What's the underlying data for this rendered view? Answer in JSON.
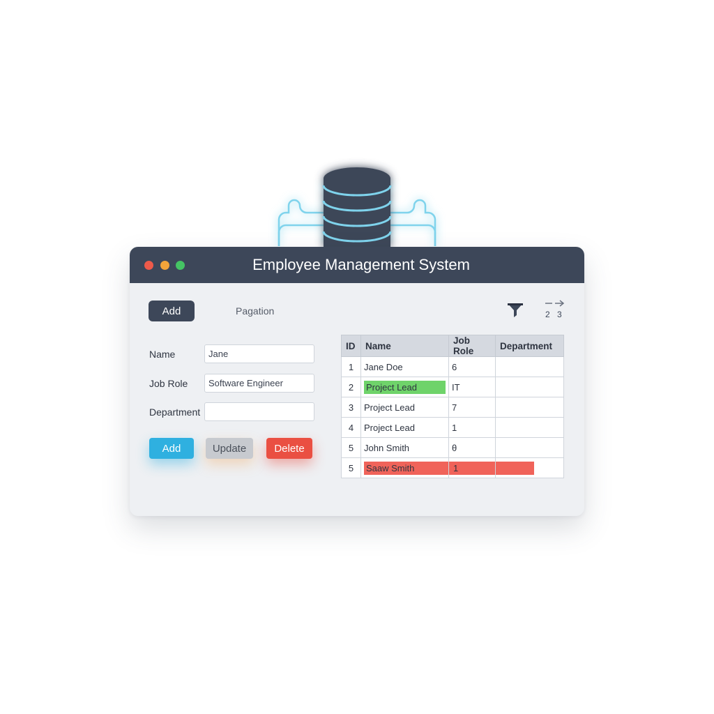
{
  "window": {
    "title": "Employee Management System"
  },
  "colors": {
    "titlebar": "#3d4759",
    "dot_red": "#ee5a4a",
    "dot_yellow": "#f2a43a",
    "dot_green": "#45c464",
    "accent_blue": "#2fb0e0",
    "danger_red": "#ea4f42",
    "highlight_green": "#6fd36a",
    "highlight_red": "#f0635a"
  },
  "toolbar": {
    "add_label": "Add",
    "pagination_label": "Pagation",
    "filter_icon": "filter-funnel-icon",
    "pager_icon": "pagination-arrows-icon",
    "pager_numbers": [
      "2",
      "3"
    ]
  },
  "form": {
    "fields": [
      {
        "label": "Name",
        "value": "Jane"
      },
      {
        "label": "Job Role",
        "value": "Software Engineer"
      },
      {
        "label": "Department",
        "value": ""
      }
    ],
    "buttons": {
      "add": "Add",
      "update": "Update",
      "delete": "Delete"
    }
  },
  "table": {
    "headers": [
      "ID",
      "Name",
      "Job Role",
      "Department"
    ],
    "rows": [
      {
        "id": "1",
        "name": "Jane Doe",
        "job_role": "6",
        "department": "",
        "highlight": ""
      },
      {
        "id": "2",
        "name": "Project Lead",
        "job_role": "IT",
        "department": "",
        "highlight": "green"
      },
      {
        "id": "3",
        "name": "Project Lead",
        "job_role": "7",
        "department": "",
        "highlight": ""
      },
      {
        "id": "4",
        "name": "Project Lead",
        "job_role": "1",
        "department": "",
        "highlight": ""
      },
      {
        "id": "5",
        "name": "John Smith",
        "job_role": "θ",
        "department": "",
        "highlight": ""
      },
      {
        "id": "5",
        "name": "Saaw Smith",
        "job_role": "1",
        "department": "",
        "highlight": "red"
      }
    ]
  }
}
